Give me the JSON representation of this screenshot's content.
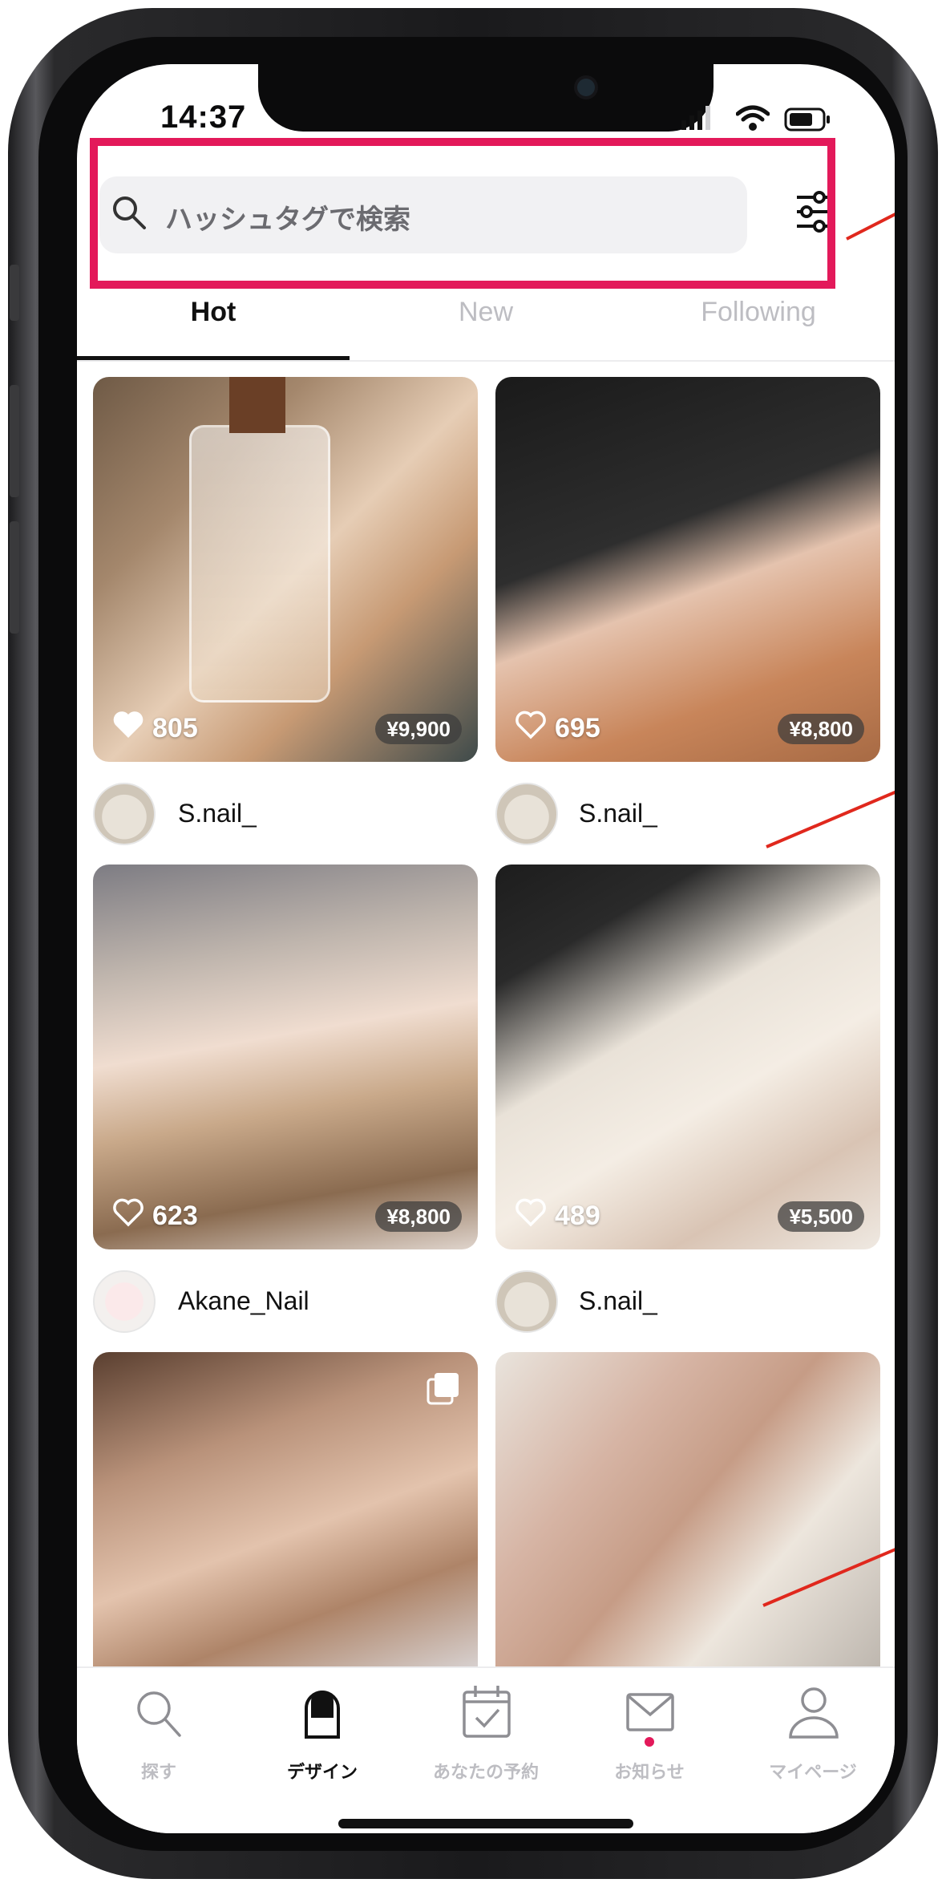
{
  "status_bar": {
    "time": "14:37"
  },
  "search": {
    "placeholder": "ハッシュタグで検索"
  },
  "tabs": [
    {
      "label": "Hot",
      "active": true
    },
    {
      "label": "New",
      "active": false
    },
    {
      "label": "Following",
      "active": false
    }
  ],
  "posts": [
    {
      "likes": "805",
      "liked": true,
      "price": "¥9,900",
      "user": "S.nail_"
    },
    {
      "likes": "695",
      "liked": false,
      "price": "¥8,800",
      "user": "S.nail_"
    },
    {
      "likes": "623",
      "liked": false,
      "price": "¥8,800",
      "user": "Akane_Nail"
    },
    {
      "likes": "489",
      "liked": false,
      "price": "¥5,500",
      "user": "S.nail_"
    },
    {
      "likes": "",
      "liked": false,
      "price": "",
      "user": "",
      "multi_image": true
    },
    {
      "likes": "",
      "liked": false,
      "price": "",
      "user": ""
    }
  ],
  "bottom_nav": [
    {
      "label": "探す",
      "icon": "search-icon",
      "active": false
    },
    {
      "label": "デザイン",
      "icon": "nail-icon",
      "active": true
    },
    {
      "label": "あなたの予約",
      "icon": "calendar-icon",
      "active": false
    },
    {
      "label": "お知らせ",
      "icon": "mail-icon",
      "active": false,
      "badge": true
    },
    {
      "label": "マイページ",
      "icon": "person-icon",
      "active": false
    }
  ],
  "colors": {
    "highlight": "#e3195a",
    "annotation": "#e0281d",
    "badge": "#e3195a"
  }
}
